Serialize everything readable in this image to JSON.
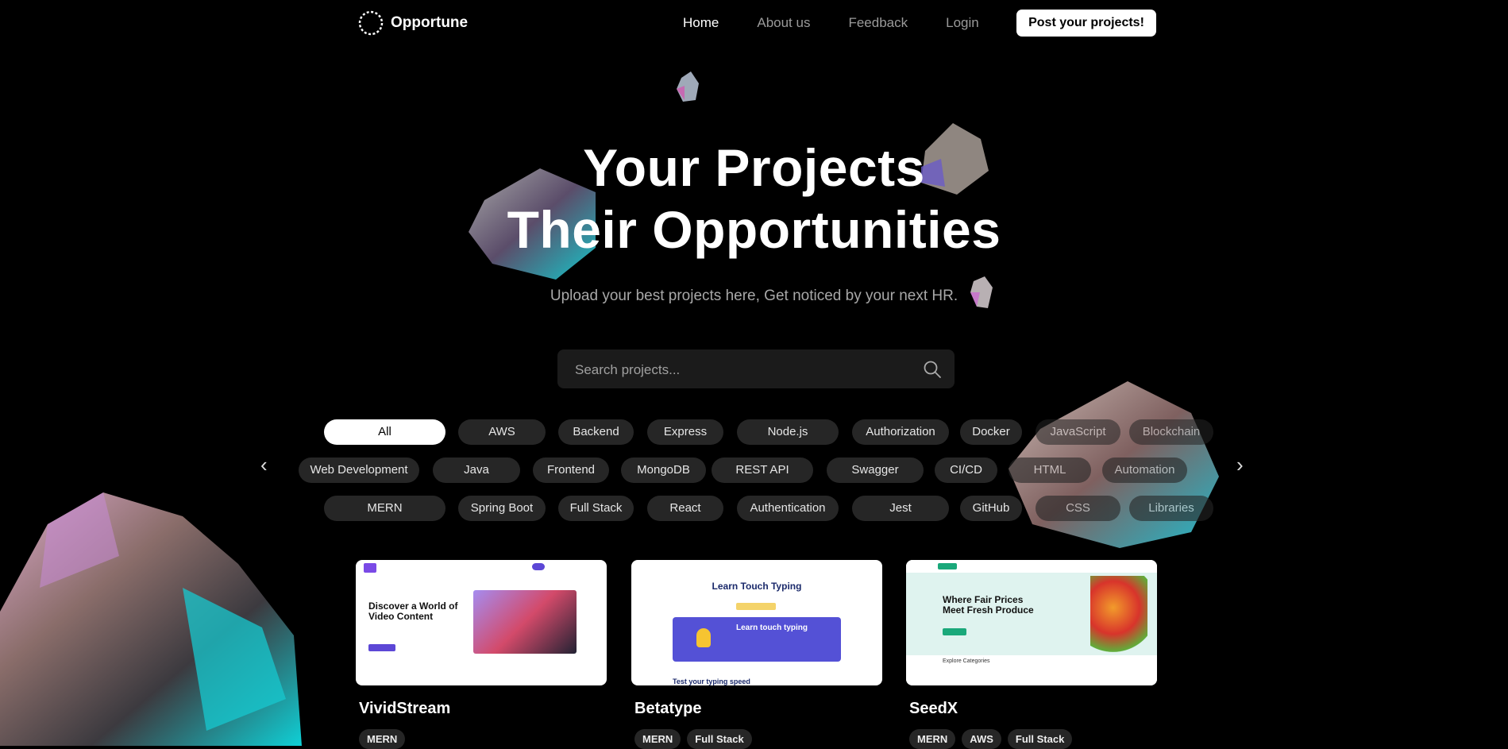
{
  "nav": {
    "brand": "Opportune",
    "links": [
      "Home",
      "About us",
      "Feedback",
      "Login"
    ],
    "cta": "Post your projects!"
  },
  "hero": {
    "title_line1": "Your Projects",
    "title_line2": "Their Opportunities",
    "subtitle": "Upload your best projects here, Get noticed by your next HR."
  },
  "search": {
    "placeholder": "Search projects..."
  },
  "tags": {
    "row1": [
      "All",
      "AWS",
      "Backend",
      "Express",
      "Node.js",
      "Authorization",
      "Docker",
      "JavaScript",
      "Blockchain"
    ],
    "row2": [
      "Web Development",
      "Java",
      "Frontend",
      "MongoDB",
      "REST API",
      "Swagger",
      "CI/CD",
      "HTML",
      "Automation"
    ],
    "row3": [
      "MERN",
      "Spring Boot",
      "Full Stack",
      "React",
      "Authentication",
      "Jest",
      "GitHub",
      "CSS",
      "Libraries"
    ],
    "active": "All"
  },
  "projects": [
    {
      "title": "VividStream",
      "tags": [
        "MERN"
      ],
      "preview": {
        "headline_1": "Discover a World of",
        "headline_2": "Video Content"
      }
    },
    {
      "title": "Betatype",
      "tags": [
        "MERN",
        "Full Stack"
      ],
      "preview": {
        "headline": "Learn Touch Typing",
        "banner": "Learn touch typing",
        "footer": "Test your typing speed"
      }
    },
    {
      "title": "SeedX",
      "tags": [
        "MERN",
        "AWS",
        "Full Stack"
      ],
      "preview": {
        "headline_1": "Where Fair Prices",
        "headline_2": "Meet Fresh Produce",
        "section": "Explore Categories"
      }
    }
  ],
  "colors": {
    "background": "#000000",
    "chip": "#262626",
    "accent": "#ffffff"
  }
}
